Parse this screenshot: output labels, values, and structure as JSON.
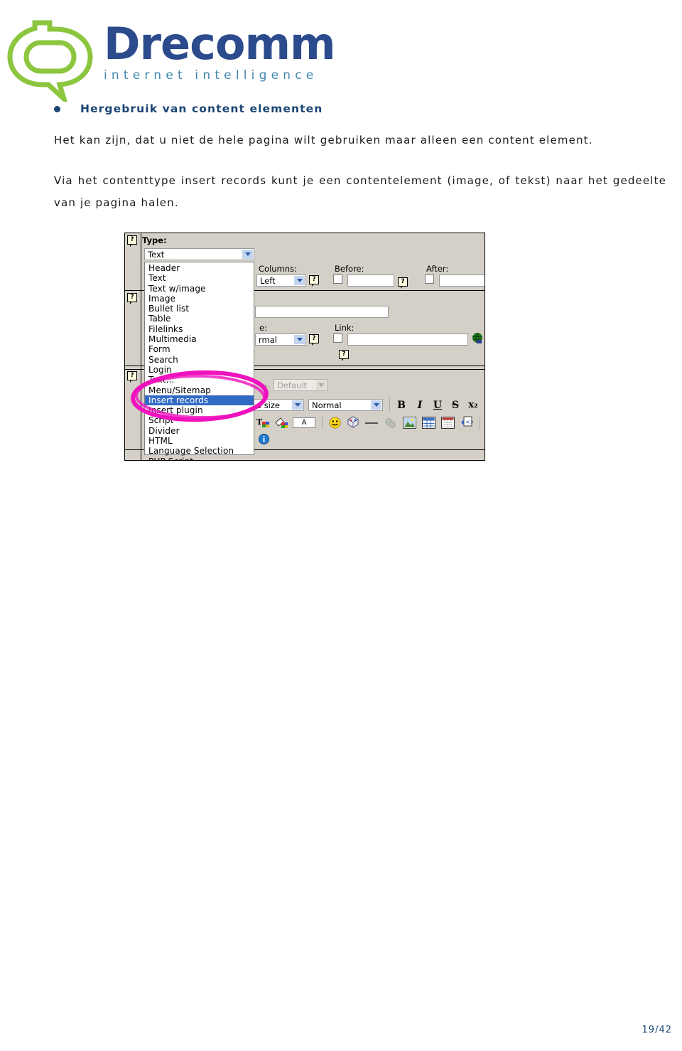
{
  "brand": {
    "name": "Drecomm",
    "tagline": "internet intelligence",
    "logo_icon": "drecomm-q-speech-bubble-logo",
    "name_color": "#2b4b8c",
    "tagline_color": "#3f87ad",
    "mark_color": "#8cc63f"
  },
  "document": {
    "heading": "Hergebruik van content elementen",
    "heading_color": "#1a4575",
    "paragraph_1": "Het kan zijn, dat u niet de hele pagina wilt gebruiken maar alleen een content element.",
    "paragraph_2": "Via het contenttype insert records kunt je een contentelement (image, of tekst) naar het gedeelte van je pagina halen.",
    "page_number": "19/42"
  },
  "screenshot": {
    "type_label": "Type:",
    "type_value": "Text",
    "columns_label": "Columns:",
    "columns_value": "Left",
    "before_label": "Before:",
    "before_value": "",
    "after_label": "After:",
    "after_value": "",
    "header_value": "",
    "type2_label": "e:",
    "type2_value": "rmal",
    "link_label": "Link:",
    "link_value": "",
    "link_browse_icon": "globe-browse-icon",
    "style_label": "t:",
    "style_value": "Default",
    "fontsize_value": "o size",
    "format_value": "Normal",
    "annotation_color": "#ff00cc",
    "annotation_name": "magenta-circle-highlight",
    "dropdown": {
      "options": [
        "Header",
        "Text",
        "Text w/image",
        "Image",
        "Bullet list",
        "Table",
        "Filelinks",
        "Multimedia",
        "Form",
        "Search",
        "Login",
        "Text...",
        "Menu/Sitemap",
        "Insert records",
        "Insert plugin",
        "Script",
        "Divider",
        "HTML",
        "Language Selection",
        "PHP Script"
      ],
      "selected": "Insert records",
      "selected_index": 13,
      "selected_bg": "#316ac5"
    },
    "format_buttons": [
      {
        "label": "B",
        "name": "bold-button"
      },
      {
        "label": "I",
        "name": "italic-button"
      },
      {
        "label": "U",
        "name": "underline-button"
      },
      {
        "label": "S",
        "name": "strikethrough-button"
      },
      {
        "label": "x₂",
        "name": "subscript-button"
      }
    ],
    "toolbar_icons": [
      "text-color-icon",
      "highlight-color-icon",
      "remove-format-icon",
      "smiley-icon",
      "special-character-icon",
      "horizontal-rule-icon",
      "link-icon",
      "insert-image-icon",
      "insert-table-icon",
      "table-grid-icon",
      "source-code-icon"
    ],
    "info_icon": "info-icon",
    "help_icon": "help-question-icon"
  }
}
